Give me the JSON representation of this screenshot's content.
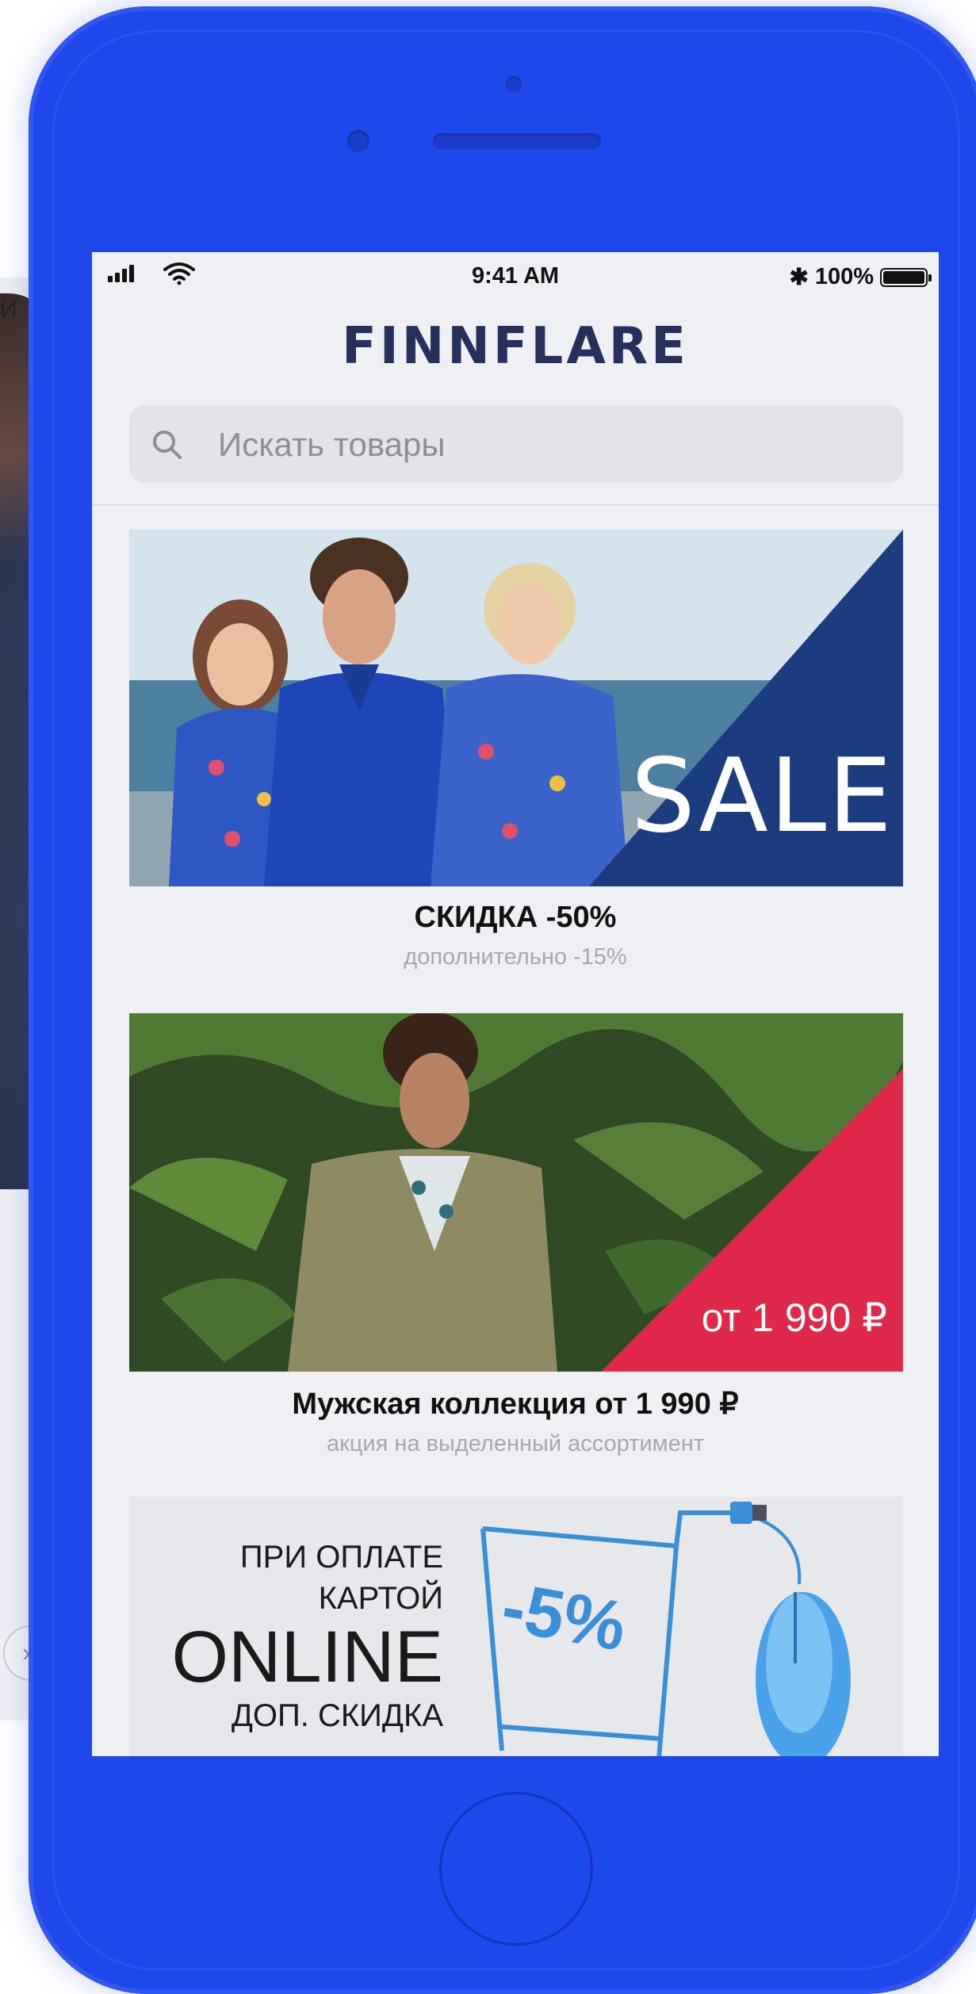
{
  "background": {
    "card_label": "И",
    "back_glyph": "›"
  },
  "statusbar": {
    "time": "9:41 AM",
    "bluetooth": "✱",
    "battery": "100%"
  },
  "app": {
    "brand": "FINNFLARE"
  },
  "search": {
    "placeholder": "Искать товары"
  },
  "banners": [
    {
      "badge": "SALE",
      "badge_color": "#1b3c7e",
      "title": "СКИДКА -50%",
      "subtitle": "дополнительно -15%"
    },
    {
      "badge": "от 1 990 ₽",
      "badge_color": "#e0284b",
      "title": "Мужская коллекция от 1 990 ₽",
      "subtitle": "акция на выделенный ассортимент"
    },
    {
      "lines": [
        "ПРИ ОПЛАТЕ",
        "КАРТОЙ",
        "ONLINE",
        "ДОП. СКИДКА"
      ],
      "discount": "-5%",
      "accent_color": "#3a90d8"
    }
  ],
  "colors": {
    "phone": "#1f48ea",
    "screen_bg": "#eff0f3",
    "brand": "#25305d"
  }
}
